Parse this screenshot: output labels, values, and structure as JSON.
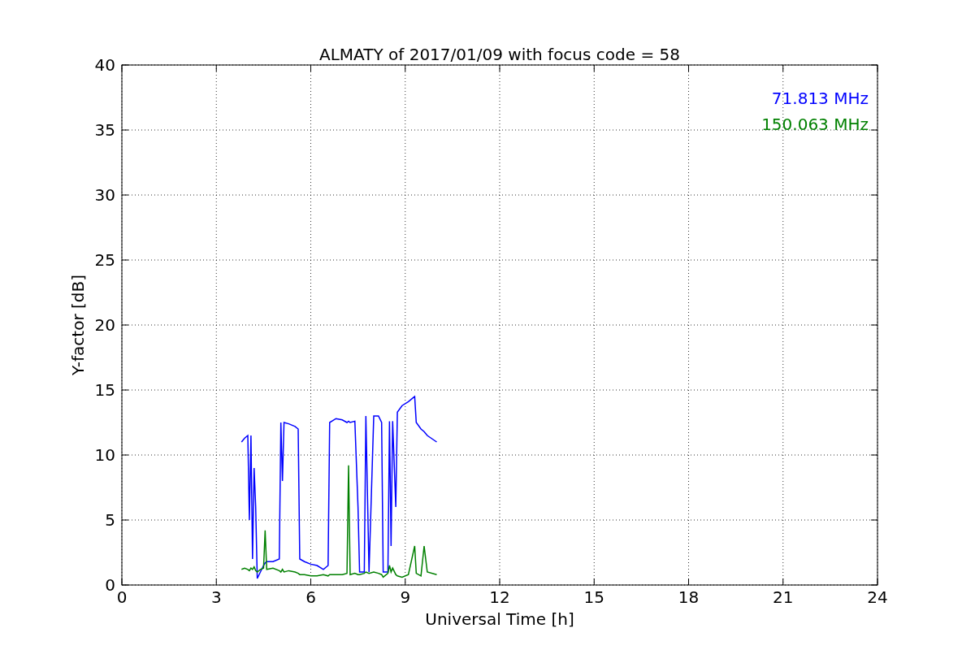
{
  "chart_data": {
    "type": "line",
    "title": "ALMATY of 2017/01/09 with focus code = 58",
    "xlabel": "Universal Time [h]",
    "ylabel": "Y-factor [dB]",
    "x": [
      3.8,
      3.9,
      4.0,
      4.05,
      4.1,
      4.15,
      4.2,
      4.25,
      4.3,
      4.4,
      4.5,
      4.55,
      4.6,
      4.8,
      5.0,
      5.05,
      5.1,
      5.15,
      5.3,
      5.5,
      5.6,
      5.65,
      5.8,
      6.0,
      6.2,
      6.4,
      6.55,
      6.6,
      6.8,
      7.0,
      7.15,
      7.2,
      7.25,
      7.4,
      7.5,
      7.55,
      7.7,
      7.75,
      7.85,
      8.0,
      8.15,
      8.25,
      8.3,
      8.45,
      8.5,
      8.55,
      8.6,
      8.7,
      8.75,
      8.9,
      9.1,
      9.3,
      9.35,
      9.5,
      9.6,
      9.7,
      10.0
    ],
    "series": [
      {
        "name": "71.813 MHz",
        "color": "#0000ff",
        "values": [
          11,
          11.3,
          11.5,
          5,
          11.5,
          2,
          9,
          6,
          0.5,
          1,
          1.5,
          1.7,
          1.8,
          1.8,
          2,
          12.5,
          8,
          12.5,
          12.4,
          12.2,
          12,
          2,
          1.8,
          1.6,
          1.5,
          1.2,
          1.5,
          12.5,
          12.8,
          12.7,
          12.5,
          12.6,
          12.5,
          12.6,
          6,
          1,
          1,
          13,
          1,
          13,
          13,
          12.5,
          1,
          1,
          12.6,
          3,
          12.6,
          6,
          13.3,
          13.8,
          14.1,
          14.5,
          12.5,
          12,
          11.8,
          11.5,
          11
        ]
      },
      {
        "name": "150.063 MHz",
        "color": "#008000",
        "values": [
          1.2,
          1.3,
          1.2,
          1.1,
          1.3,
          1.2,
          1.4,
          1.1,
          1.0,
          1.2,
          1.3,
          4.2,
          1.2,
          1.3,
          1.1,
          1.0,
          1.2,
          1.0,
          1.1,
          1.0,
          0.9,
          0.8,
          0.8,
          0.7,
          0.7,
          0.8,
          0.7,
          0.8,
          0.8,
          0.8,
          0.9,
          9.2,
          0.8,
          0.9,
          0.8,
          0.8,
          0.9,
          1.0,
          0.9,
          1.0,
          0.9,
          0.8,
          0.6,
          0.9,
          1.5,
          1.0,
          1.3,
          0.8,
          0.7,
          0.6,
          0.8,
          3.0,
          0.9,
          0.7,
          3.0,
          1.0,
          0.8
        ]
      }
    ],
    "grid": true,
    "xlim": [
      0,
      24
    ],
    "ylim": [
      0,
      40
    ],
    "xticks": [
      0,
      3,
      6,
      9,
      12,
      15,
      18,
      21,
      24
    ],
    "yticks": [
      0,
      5,
      10,
      15,
      20,
      25,
      30,
      35,
      40
    ]
  }
}
